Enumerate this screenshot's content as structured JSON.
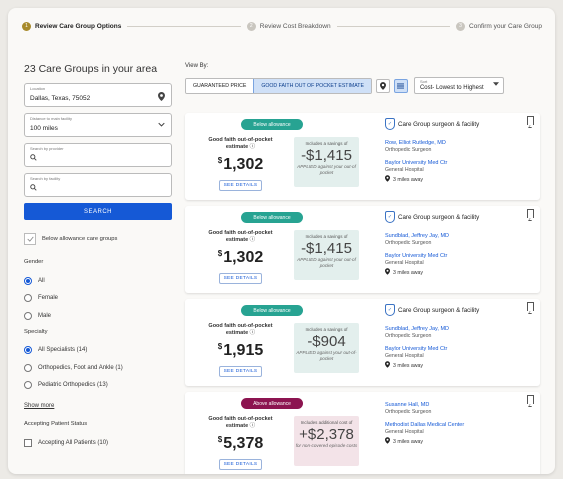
{
  "stepper": {
    "steps": [
      {
        "num": "1",
        "label": "Review Care Group Options"
      },
      {
        "num": "2",
        "label": "Review Cost Breakdown"
      },
      {
        "num": "3",
        "label": "Confirm your Care Group"
      }
    ]
  },
  "results_title": "23 Care Groups in your area",
  "location": {
    "label": "Location",
    "value": "Dallas, Texas, 75052"
  },
  "distance": {
    "label": "Distance to main facility",
    "value": "100 miles"
  },
  "search_provider": {
    "label": "Search by provider"
  },
  "search_facility": {
    "label": "Search by facility"
  },
  "search_button": "SEARCH",
  "below_allowance_toggle": "Below allowance care groups",
  "gender": {
    "title": "Gender",
    "options": [
      {
        "label": "All",
        "selected": true
      },
      {
        "label": "Female",
        "selected": false
      },
      {
        "label": "Male",
        "selected": false
      }
    ]
  },
  "specialty": {
    "title": "Specialty",
    "options": [
      {
        "label": "All Specialists (14)",
        "selected": true
      },
      {
        "label": "Orthopedics, Foot and Ankle (1)",
        "selected": false
      },
      {
        "label": "Pediatric Orthopedics (13)",
        "selected": false
      }
    ],
    "show_more": "Show more"
  },
  "accepting": {
    "title": "Accepting Patient Status",
    "option": "Accepting All Patients (10)"
  },
  "view_by": {
    "label": "View By:",
    "options": [
      "GUARANTEED PRICE",
      "GOOD FAITH OUT OF POCKET ESTIMATE"
    ]
  },
  "sort": {
    "label": "Sort",
    "value": "Cost- Lowest to Highest"
  },
  "icons": {
    "location": "location-pin-icon",
    "list": "list-view-icon",
    "chevron": "chevron-down-icon",
    "search": "search-icon",
    "bookmark": "bookmark-icon",
    "shield": "shield-icon"
  },
  "colors": {
    "primary": "#1559d6",
    "below": "#27a392",
    "above": "#8c1450",
    "step_active": "#a78a2b"
  },
  "cards": [
    {
      "badge": "Below allowance",
      "est_label": "Good faith out-of-pocket estimate",
      "price": "1,302",
      "details": "SEE DETAILS",
      "save_line1": "Includes a savings of",
      "save_amount": "-$1,415",
      "save_line2": "APPLIED against your out-of pocket",
      "group": "Care Group surgeon & facility",
      "doctor": "Row, Elliot Rutledge, MD",
      "doctor_spec": "Orthopedic Surgeon",
      "facility": "Baylor University Med Ctr",
      "facility_type": "General Hospital",
      "miles": "3 miles away"
    },
    {
      "badge": "Below allowance",
      "est_label": "Good faith out-of-pocket estimate",
      "price": "1,302",
      "details": "SEE DETAILS",
      "save_line1": "Includes a savings of",
      "save_amount": "-$1,415",
      "save_line2": "APPLIED against your out-of pocket",
      "group": "Care Group surgeon & facility",
      "doctor": "Sundblad, Jeffrey Jay, MD",
      "doctor_spec": "Orthopedic Surgeon",
      "facility": "Baylor University Med Ctr",
      "facility_type": "General Hospital",
      "miles": "3 miles away"
    },
    {
      "badge": "Below allowance",
      "est_label": "Good faith out-of-pocket estimate",
      "price": "1,915",
      "details": "SEE DETAILS",
      "save_line1": "Includes a savings of",
      "save_amount": "-$904",
      "save_line2": "APPLIED against your out-of-pocket",
      "group": "Care Group surgeon & facility",
      "doctor": "Sundblad, Jeffrey Jay, MD",
      "doctor_spec": "Orthopedic Surgeon",
      "facility": "Baylor University Med Ctr",
      "facility_type": "General Hospital",
      "miles": "3 miles away"
    },
    {
      "badge": "Above allowance",
      "est_label": "Good faith out-of-pocket estimate",
      "price": "5,378",
      "details": "SEE DETAILS",
      "save_line1": "Includes additional cost of",
      "save_amount": "+$2,378",
      "save_line2": "for non-covered episode costs",
      "group": "Care Group surgeon & facility",
      "doctor": "Susanne Hall, MD",
      "doctor_spec": "Orthopedic Surgeon",
      "facility": "Methodist Dallas Medical Center",
      "facility_type": "General Hospital",
      "miles": "3 miles away"
    }
  ]
}
